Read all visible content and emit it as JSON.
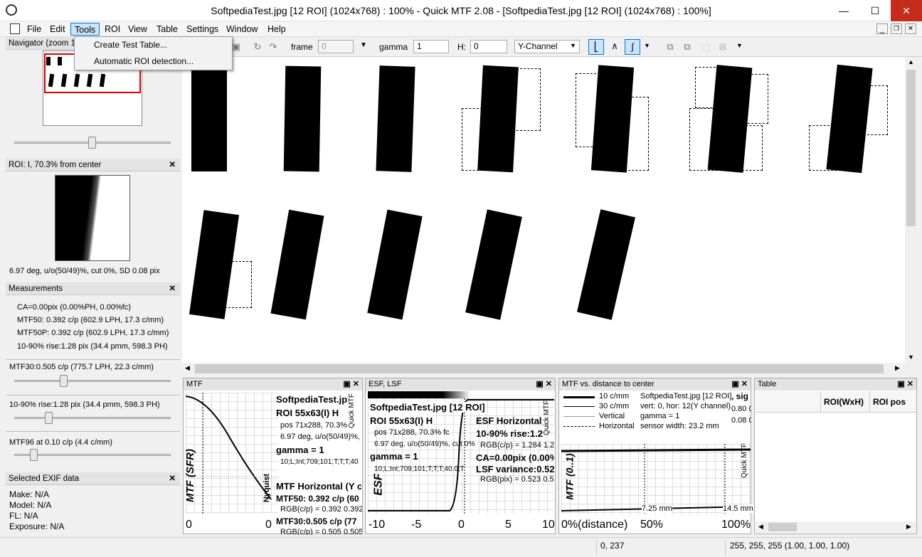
{
  "window": {
    "title": "SoftpediaTest.jpg [12 ROI] (1024x768) : 100% - Quick MTF 2.08 - [SoftpediaTest.jpg [12 ROI] (1024x768) : 100%]",
    "minimize": "—",
    "maximize": "☐",
    "close": "✕"
  },
  "menu": {
    "items": [
      "File",
      "Edit",
      "Tools",
      "ROI",
      "View",
      "Table",
      "Settings",
      "Window",
      "Help"
    ]
  },
  "tools_menu": {
    "items": [
      "Create Test Table...",
      "Automatic ROI detection..."
    ]
  },
  "toolbar": {
    "frame_label": "frame",
    "frame_value": "0",
    "gamma_label": "gamma",
    "gamma_value": "1",
    "h_label": "H:",
    "h_value": "0",
    "channel": "Y-Channel"
  },
  "navigator": {
    "title": "Navigator (zoom 1"
  },
  "roi_panel": {
    "title": "ROI: I, 70.3% from center",
    "caption": "6.97 deg, u/o(50/49)%, cut 0%, SD 0.08 pix"
  },
  "measurements": {
    "title": "Measurements",
    "lines": [
      "CA=0.00pix (0.00%PH, 0.00%fc)",
      "MTF50: 0.392 c/p (602.9 LPH, 17.3 c/mm)",
      "MTF50P: 0.392 c/p (602.9 LPH, 17.3 c/mm)",
      "10-90% rise:1.28 pix (34.4 pmm, 598.3 PH)"
    ],
    "slider1": "MTF30:0.505 c/p (775.7 LPH, 22.3 c/mm)",
    "slider2": "10-90% rise:1.28 pix (34.4 pmm, 598.3 PH)",
    "slider3": "MTF96 at 0.10 c/p (4.4 c/mm)"
  },
  "exif": {
    "title": "Selected EXIF data",
    "lines": [
      "Make: N/A",
      "Model: N/A",
      "FL: N/A",
      "Exposure: N/A"
    ]
  },
  "mtf_panel": {
    "title": "MTF",
    "ylabel": "MTF (SFR)",
    "nyquist": "Nyquist",
    "lines": [
      "SoftpediaTest.jp",
      "ROI 55x63(I) H",
      "pos 71x288, 70.3%",
      "6.97 deg, u/o(50/49)%,",
      "gamma = 1",
      "10;L;Int;709;101;T;T;T;40",
      "MTF Horizontal (Y c",
      "MTF50: 0.392 c/p (60",
      "RGB(c/p) = 0.392 0.392",
      "MTF30:0.505 c/p (77",
      "RGB(c/p) = 0.505 0.505"
    ],
    "xticks": [
      "0",
      "0"
    ],
    "side": "Quick MTF"
  },
  "esf_panel": {
    "title": "ESF, LSF",
    "ylabel": "ESF",
    "lines": [
      "SoftpediaTest.jpg [12 ROI]",
      "ROI 55x63(I) H",
      "pos 71x288, 70.3% fc",
      "6.97 deg, u/o(50/49)%, cut 0%",
      "gamma = 1",
      "10;L;Int;709;101;T;T;T;40.0;T"
    ],
    "right_lines": [
      "ESF Horizontal",
      "10-90% rise:1.2",
      "RGB(c/p) = 1.284 1.28",
      "CA=0.00pix (0.00%",
      "LSF variance:0.52",
      "RGB(pix) = 0.523 0.52"
    ],
    "xticks": [
      "-10",
      "-5",
      "0",
      "5",
      "10"
    ],
    "side": "Quick MTF"
  },
  "dist_panel": {
    "title": "MTF vs. distance to center",
    "legend": [
      "10 c/mm",
      "30 c/mm",
      "Vertical",
      "Horizontal"
    ],
    "info": [
      "SoftpediaTest.jpg [12 ROI]",
      "vert: 0, hor: 12(Y channel)",
      "gamma = 1",
      "sensor width: 23.2 mm"
    ],
    "right": [
      ", sig",
      "0.80 0",
      "0.08 0"
    ],
    "ylabel": "MTF (0..1)",
    "marks": [
      "7.25 mm",
      "14.5 mm"
    ],
    "xticks": [
      "0%(distance)",
      "50%",
      "100%"
    ],
    "side": "Quick MTF"
  },
  "table_panel": {
    "title": "Table",
    "columns": [
      "ROI(WxH)",
      "ROI pos"
    ]
  },
  "status": {
    "coords": "0, 237",
    "pixel": "255, 255, 255 (1.00, 1.00, 1.00)"
  },
  "colors": {
    "accent": "#0078d7",
    "nav_roi": "#e00000"
  }
}
